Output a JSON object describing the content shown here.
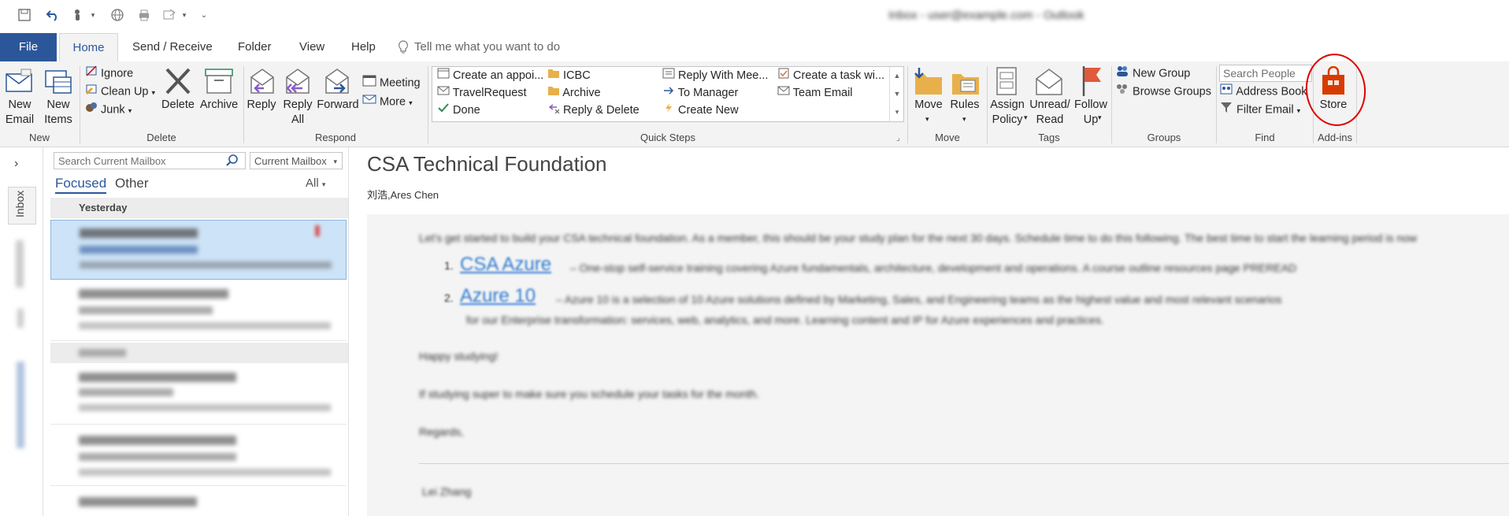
{
  "window": {
    "title": "Inbox - user@example.com - Outlook"
  },
  "tabs": [
    {
      "label": "File"
    },
    {
      "label": "Home"
    },
    {
      "label": "Send / Receive"
    },
    {
      "label": "Folder"
    },
    {
      "label": "View"
    },
    {
      "label": "Help"
    }
  ],
  "tell_me": {
    "placeholder": "Tell me what you want to do"
  },
  "ribbon": {
    "new": {
      "email": "New\nEmail",
      "items": "New\nItems",
      "group": "New"
    },
    "delete": {
      "ignore": "Ignore",
      "cleanup": "Clean Up",
      "junk": "Junk",
      "delete": "Delete",
      "archive": "Archive",
      "group": "Delete"
    },
    "respond": {
      "reply": "Reply",
      "reply_all": "Reply\nAll",
      "forward": "Forward",
      "meeting": "Meeting",
      "more": "More",
      "group": "Respond"
    },
    "quicksteps": {
      "items": [
        "Create an appoi...",
        "ICBC",
        "Reply With Mee...",
        "Create a task wi...",
        "TravelRequest",
        "Archive",
        "To Manager",
        "Team Email",
        "Done",
        "Reply & Delete",
        "Create New"
      ],
      "group": "Quick Steps"
    },
    "move": {
      "move": "Move",
      "rules": "Rules",
      "group": "Move"
    },
    "tags": {
      "assign": "Assign\nPolicy",
      "unread": "Unread/\nRead",
      "follow": "Follow\nUp",
      "group": "Tags"
    },
    "groups": {
      "new_group": "New Group",
      "browse": "Browse Groups",
      "group": "Groups"
    },
    "find": {
      "search_people": "Search People",
      "address_book": "Address Book",
      "filter": "Filter Email",
      "group": "Find"
    },
    "addins": {
      "store": "Store",
      "group": "Add-ins"
    }
  },
  "nav": {
    "inbox": "Inbox"
  },
  "maillist": {
    "search_placeholder": "Search Current Mailbox",
    "scope": "Current Mailbox",
    "focused": "Focused",
    "other": "Other",
    "filter": "All",
    "group_yesterday": "Yesterday"
  },
  "message": {
    "subject": "CSA Technical Foundation",
    "from": "刘浩,Ares Chen",
    "link1": "CSA Azure",
    "link2": "Azure 10"
  },
  "colors": {
    "accent": "#2b579a",
    "store": "#d83b01",
    "annotation": "#e00000"
  }
}
